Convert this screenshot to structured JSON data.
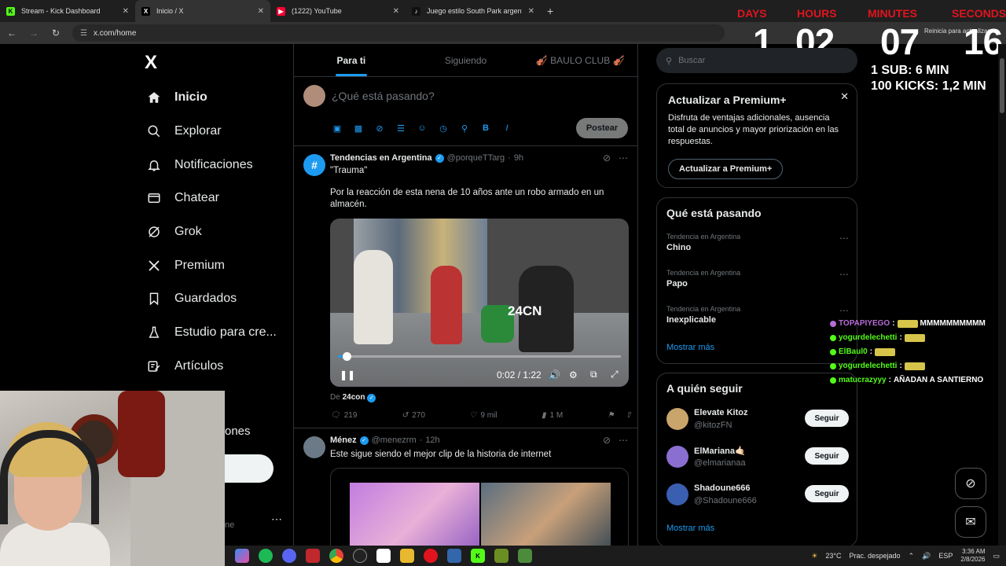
{
  "browser": {
    "tabs": [
      {
        "title": "Stream - Kick Dashboard",
        "fav": "K",
        "fav_color": "#53fc18",
        "fav_text": "#000"
      },
      {
        "title": "Inicio / X",
        "fav": "X",
        "fav_color": "#000",
        "fav_text": "#fff"
      },
      {
        "title": "(1222) YouTube",
        "fav": "▶",
        "fav_color": "#ff0033",
        "fav_text": "#fff"
      },
      {
        "title": "Juego estilo South Park argentin",
        "fav": "♪",
        "fav_color": "#111",
        "fav_text": "#fff"
      }
    ],
    "url": "x.com/home",
    "restart_label": "Reinicia para actualizar"
  },
  "timer": {
    "labels": {
      "days": "DAYS",
      "hours": "HOURS",
      "minutes": "MINUTES",
      "seconds": "SECONDS"
    },
    "values": {
      "days": "1",
      "hours": "02",
      "minutes": "07",
      "seconds": "16"
    }
  },
  "sub_info": {
    "line1": "1 SUB: 6 MIN",
    "line2": "100 KICKS: 1,2 MIN"
  },
  "sidebar": {
    "logo": "X",
    "items": [
      {
        "label": "Inicio",
        "icon": "home-icon"
      },
      {
        "label": "Explorar",
        "icon": "search-icon"
      },
      {
        "label": "Notificaciones",
        "icon": "bell-icon"
      },
      {
        "label": "Chatear",
        "icon": "mail-icon"
      },
      {
        "label": "Grok",
        "icon": "grok-icon"
      },
      {
        "label": "Premium",
        "icon": "x-icon"
      },
      {
        "label": "Guardados",
        "icon": "bookmark-icon"
      },
      {
        "label": "Estudio para cre...",
        "icon": "flask-icon"
      },
      {
        "label": "Artículos",
        "icon": "edit-icon"
      }
    ],
    "partial_label": "ones",
    "partial_handle": "ne",
    "more": "⋯"
  },
  "main": {
    "tabs": [
      "Para ti",
      "Siguiendo",
      "🎻 BAULO CLUB 🎻"
    ],
    "composer": {
      "placeholder": "¿Qué está pasando?",
      "post": "Postear"
    },
    "tweet1": {
      "name": "Tendencias en Argentina",
      "handle": "@porqueTTarg",
      "time": "9h",
      "quote": "\"Trauma\"",
      "text": "Por la reacción de esta nena de 10 años ante un robo armado en un almacén.",
      "watermark": "24CN",
      "video_time": "0:02 / 1:22",
      "video_progress": 0.03,
      "source_prefix": "De",
      "source": "24con",
      "stats": {
        "replies": "219",
        "reposts": "270",
        "likes": "9 mil",
        "views": "1 M"
      }
    },
    "tweet2": {
      "name": "Ménez",
      "handle": "@menezrm",
      "time": "12h",
      "text": "Este sigue siendo el mejor clip de la historia de internet"
    }
  },
  "right": {
    "search_placeholder": "Buscar",
    "premium": {
      "title": "Actualizar a Premium+",
      "desc": "Disfruta de ventajas adicionales, ausencia total de anuncios y mayor priorización en las respuestas.",
      "button": "Actualizar a Premium+"
    },
    "trends": {
      "title": "Qué está pasando",
      "items": [
        {
          "context": "Tendencia en Argentina",
          "name": "Chino"
        },
        {
          "context": "Tendencia en Argentina",
          "name": "Papo"
        },
        {
          "context": "Tendencia en Argentina",
          "name": "Inexplicable"
        }
      ],
      "more": "Mostrar más"
    },
    "follow": {
      "title": "A quién seguir",
      "users": [
        {
          "name": "Elevate Kitoz",
          "handle": "@kitozFN",
          "color": "#c9a46b"
        },
        {
          "name": "ElMariana🤙🏻",
          "handle": "@elmarianaa",
          "color": "#8a6fd0"
        },
        {
          "name": "Shadoune666",
          "handle": "@Shadoune666",
          "color": "#3a5fb0"
        }
      ],
      "button": "Seguir",
      "more": "Mostrar más"
    }
  },
  "chat": [
    {
      "user": "TOPAPIYEGO",
      "msg": "MMMMMMMMMM",
      "color": "#b86bd8",
      "emote": true
    },
    {
      "user": "yogurdelechetti",
      "msg": "",
      "color": "#53fc18",
      "emote": true
    },
    {
      "user": "ElBaul0",
      "msg": "",
      "color": "#53fc18",
      "emote": true
    },
    {
      "user": "yogurdelechetti",
      "msg": "",
      "color": "#53fc18",
      "emote": true
    },
    {
      "user": "matucrazyyy",
      "msg": "AÑADAN A SANTIERNO",
      "color": "#53fc18",
      "emote": false
    }
  ],
  "taskbar": {
    "weather": "23°C",
    "weather_desc": "Prac. despejado",
    "lang": "ESP",
    "time": "3:36 AM",
    "date": "2/8/2026"
  }
}
